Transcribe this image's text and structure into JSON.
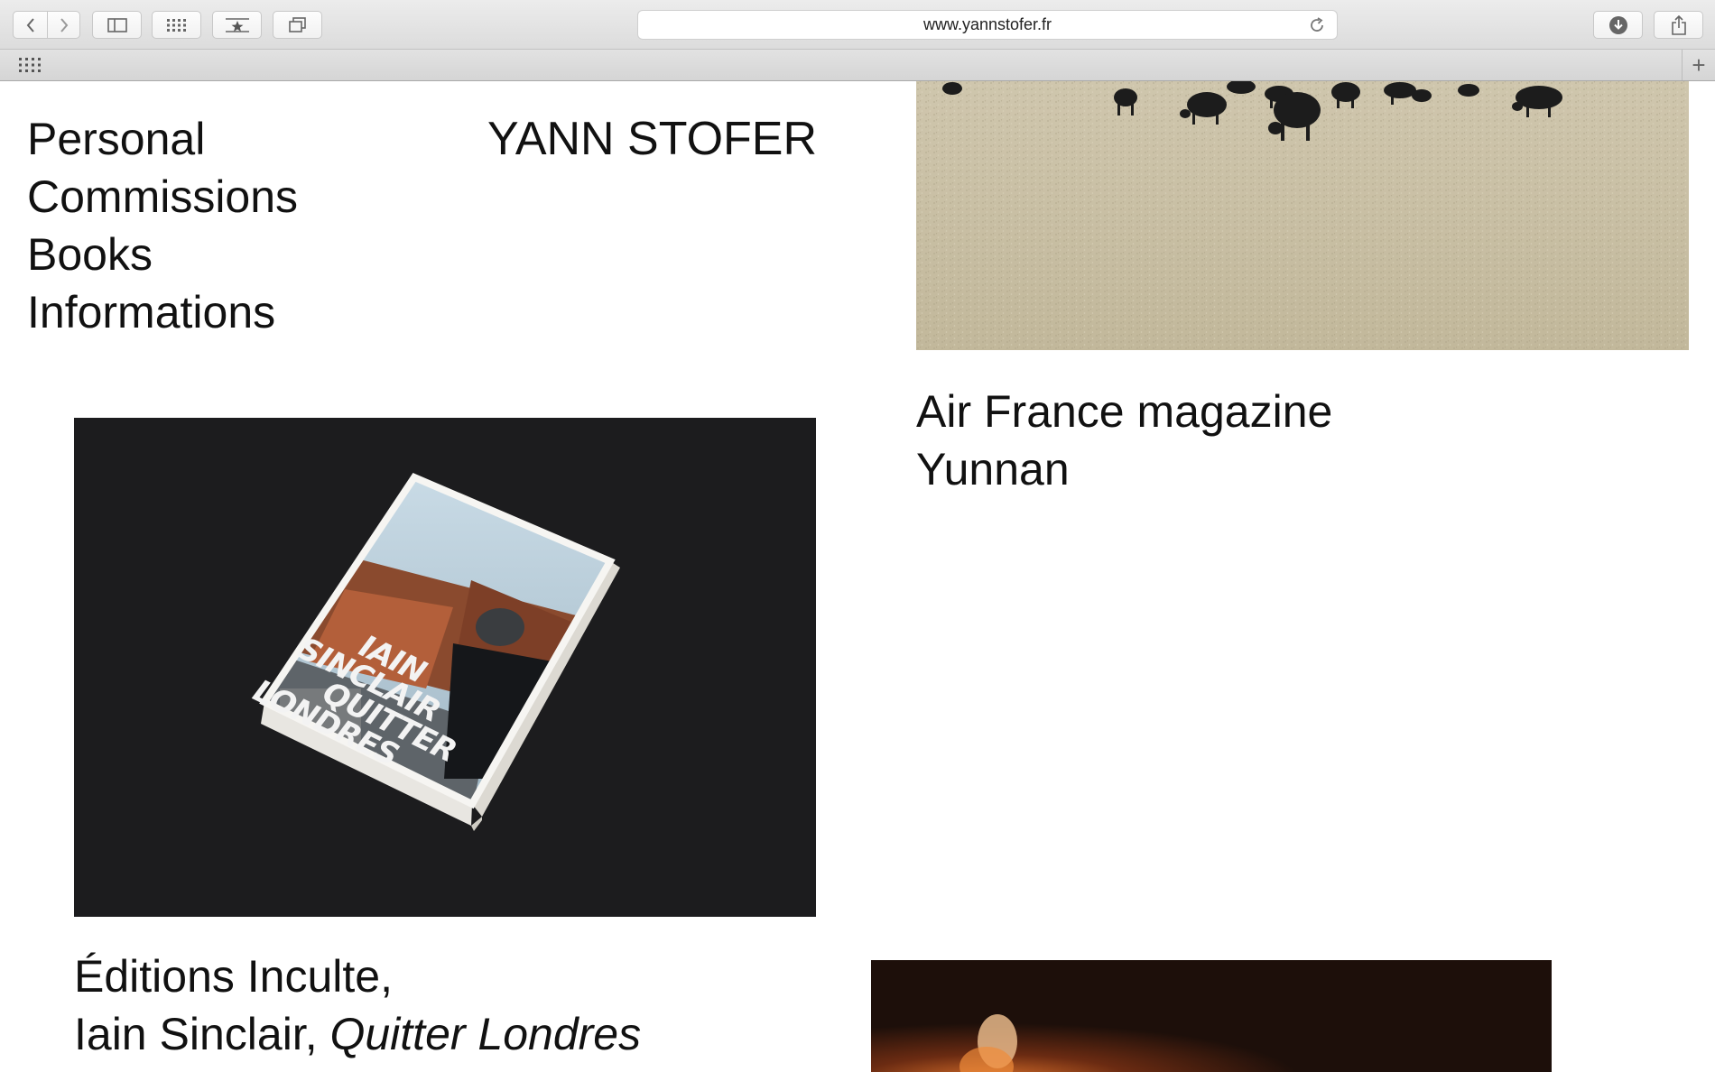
{
  "browser": {
    "url": "www.yannstofer.fr",
    "toolbar_icons": [
      "back-arrow-icon",
      "forward-arrow-icon",
      "sidebar-icon",
      "top-sites-grid-icon",
      "reader-star-icon",
      "tabs-overview-icon",
      "download-icon",
      "share-icon",
      "reload-icon"
    ],
    "favorites_bar_icon": "grid-icon",
    "new_tab_label": "+"
  },
  "site": {
    "title": "YANN STOFER",
    "nav": [
      {
        "label": "Personal"
      },
      {
        "label": "Commissions"
      },
      {
        "label": "Books"
      },
      {
        "label": "Informations"
      }
    ]
  },
  "projects": [
    {
      "image": "grazing-yaks-photo",
      "caption_line1": "Air France magazine",
      "caption_line2": "Yunnan"
    },
    {
      "image": "book-quitter-londres-photo",
      "caption_line1": "Éditions Inculte,",
      "caption_line2_author": "Iain Sinclair, ",
      "caption_line2_title": "Quitter Londres",
      "cover_text": [
        "IAIN",
        "SINCLAIR",
        "QUITTER",
        "LONDRES"
      ]
    },
    {
      "image": "firelit-scene-photo"
    }
  ],
  "colors": {
    "page_background": "#ffffff",
    "text": "#111111",
    "book_photo_background": "#1c1c1e",
    "field_color": "#c9bfa4"
  }
}
